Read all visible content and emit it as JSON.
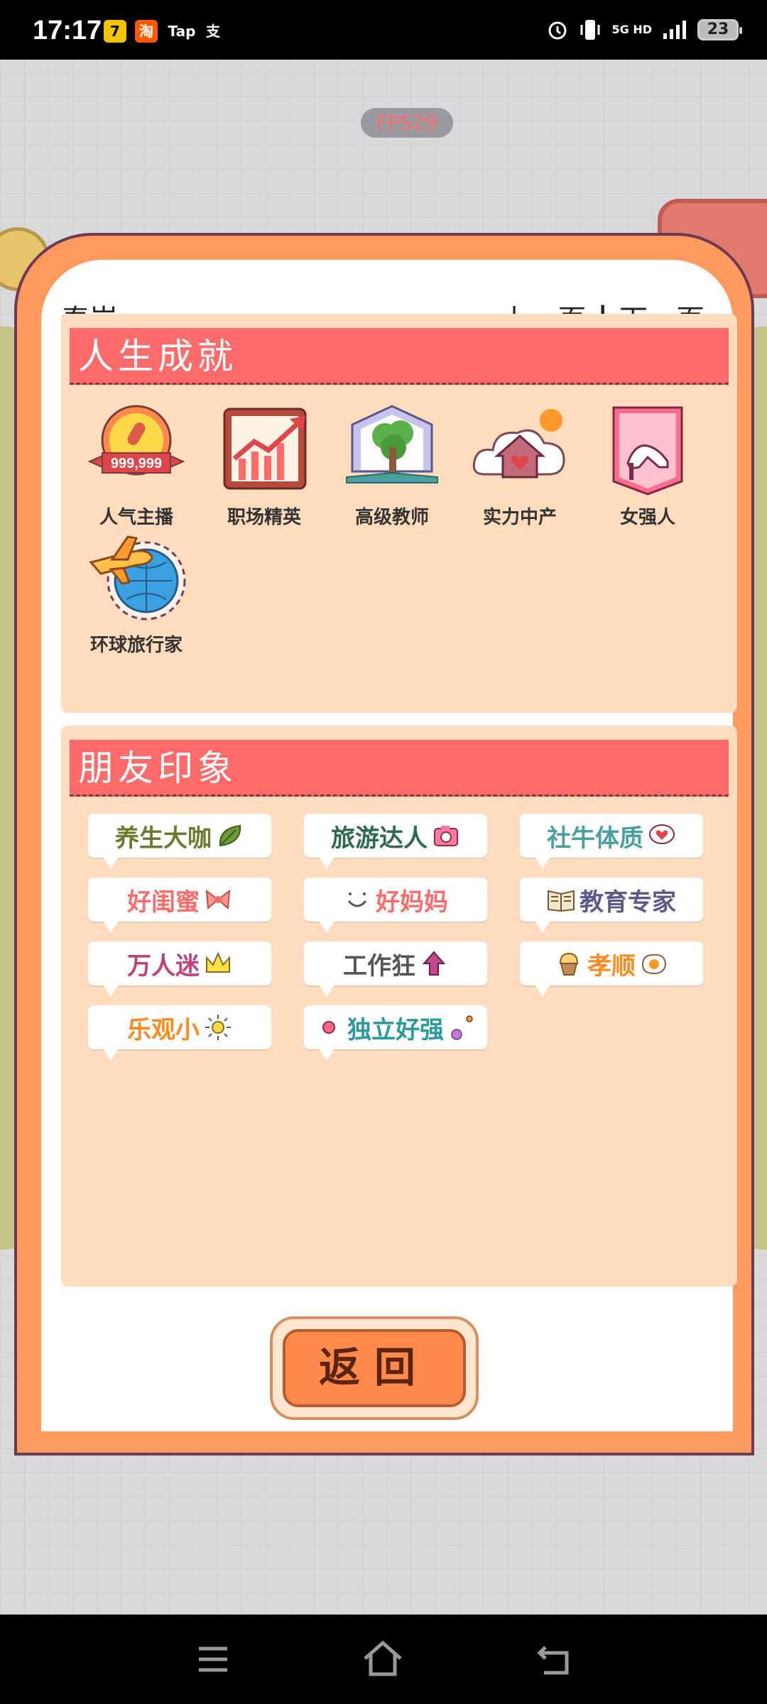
{
  "status_bar": {
    "time": "17:17",
    "network": "5G HD",
    "battery": "23",
    "app_icons": [
      "7",
      "淘",
      "Tap",
      "支"
    ]
  },
  "hud": {
    "fps": "FPS29"
  },
  "modal": {
    "player_name": "秦岚",
    "prev_page": "上一页",
    "separator": "|",
    "next_page": "下一页"
  },
  "achievements": {
    "title": "人生成就",
    "items": [
      {
        "label": "人气主播",
        "icon": "microphone-badge-icon",
        "badge_text": "999,999"
      },
      {
        "label": "职场精英",
        "icon": "rising-chart-icon"
      },
      {
        "label": "高级教师",
        "icon": "tree-book-icon"
      },
      {
        "label": "实力中产",
        "icon": "cloud-house-icon"
      },
      {
        "label": "女强人",
        "icon": "high-heel-icon"
      },
      {
        "label": "环球旅行家",
        "icon": "globe-plane-icon"
      }
    ]
  },
  "impressions": {
    "title": "朋友印象",
    "tags": [
      {
        "label": "养生大咖",
        "color": "#6b7a2e",
        "icon": "leaf-icon"
      },
      {
        "label": "旅游达人",
        "color": "#2f6b4a",
        "icon": "camera-icon"
      },
      {
        "label": "社牛体质",
        "color": "#4aa0a0",
        "icon": "heart-bubble-icon"
      },
      {
        "label": "好闺蜜",
        "color": "#ff6b6b",
        "icon": "bow-icon"
      },
      {
        "label": "好妈妈",
        "color": "#ff6b6b",
        "icon": "smile-icon"
      },
      {
        "label": "教育专家",
        "color": "#5a5a8a",
        "icon": "book-icon"
      },
      {
        "label": "万人迷",
        "color": "#c0407a",
        "icon": "crown-icon"
      },
      {
        "label": "工作狂",
        "color": "#555555",
        "icon": "arrow-up-icon"
      },
      {
        "label": "孝顺",
        "color": "#ff8a20",
        "icon": "cupcake-icon"
      },
      {
        "label": "乐观小",
        "color": "#ff8a20",
        "icon": "sun-icon"
      },
      {
        "label": "独立好强",
        "color": "#2a9a9a",
        "icon": "dots-icon"
      }
    ]
  },
  "buttons": {
    "return": "返回"
  },
  "colors": {
    "modal_frame": "#ff9a5e",
    "panel_bg": "#ffdcbe",
    "section_header": "#ff6b6b",
    "return_button": "#ff8a4c"
  }
}
